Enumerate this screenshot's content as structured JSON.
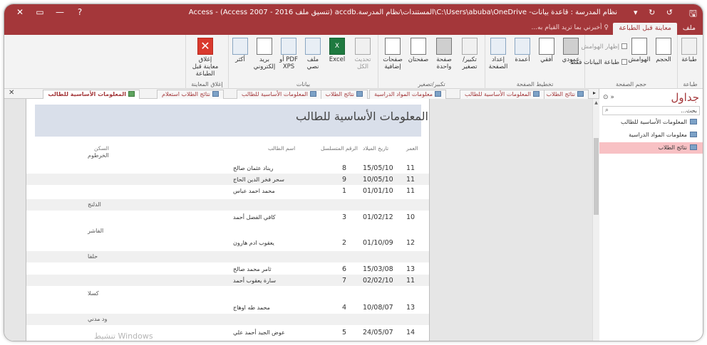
{
  "window": {
    "title": "نظام المدرسة : قاعدة بيانات- C:\\Users\\abuba\\OneDrive\\المستندات\\نظام المدرسة.accdb (تنسيق ملف 2016 - Access 2007) - Access",
    "save_icon": "save-icon",
    "quick_access": "↺ ↻ ▾",
    "controls": [
      "✕",
      "▭",
      "—",
      "?"
    ]
  },
  "tabs": {
    "file": "ملف",
    "print_preview": "معاينة قبل الطباعة",
    "tell_me": "أخبرني بما تريد القيام به..."
  },
  "ribbon": {
    "print": {
      "print": "طباعة",
      "group": "طباعة"
    },
    "page_size": {
      "size": "الحجم",
      "margins": "الهوامش",
      "show_margins": "إظهار الهوامش",
      "print_data_only": "طباعة البيانات فقط",
      "group": "حجم الصفحة"
    },
    "page_layout": {
      "portrait": "عمودي",
      "landscape": "أفقي",
      "columns": "أعمدة",
      "page_setup": "إعداد الصفحة",
      "group": "تخطيط الصفحة"
    },
    "zoom": {
      "zoom": "تكبير/تصغير",
      "one_page": "صفحة واحدة",
      "two_pages": "صفحتان",
      "more_pages": "صفحات إضافية",
      "group": "تكبير/تصغير"
    },
    "data": {
      "refresh_all": "تحديث الكل",
      "excel": "Excel",
      "text_file": "ملف نصي",
      "pdf_xps": "PDF أو XPS",
      "email": "بريد إلكتروني",
      "more": "أكثر",
      "group": "بيانات"
    },
    "close": {
      "close_preview": "إغلاق معاينة قبل الطباعة",
      "group": "إغلاق المعاينة"
    }
  },
  "doc_tabs": {
    "active": "المعلومات الأساسية للطالب",
    "tab2": "نتائج الطلاب استعلام",
    "tab3": "المعلومات الأساسية للطالب",
    "tab4": "نتائج الطلاب",
    "tab5": "معلومات المواد الدراسية",
    "tab6": "المعلومات الأساسية للطالب",
    "tab7": "نتائج الطلاب",
    "close": "✕",
    "arrow": "▸"
  },
  "nav": {
    "title": "جداول",
    "collapse": "«",
    "dropdown": "⊙",
    "search_placeholder": "بحث...",
    "search_icon": "search-icon",
    "items": [
      "المعلومات الأساسية للطالب",
      "معلومات المواد الدراسية",
      "نتائج الطلاب"
    ],
    "selected_index": 2
  },
  "report": {
    "title": "المعلومات الأساسية للطالب",
    "headers": {
      "age": "العمر",
      "dob": "تاريخ الميلاد",
      "serial": "الرقم المتسلسل",
      "name": "اسم الطالب",
      "residence": "السكن"
    },
    "groups": [
      {
        "residence": "الخرطوم",
        "rows": [
          {
            "age": "11",
            "dob": "15/05/10",
            "serial": "8",
            "name": "ريناد عثمان صالح"
          },
          {
            "age": "11",
            "dob": "10/05/10",
            "serial": "9",
            "name": "سحر فخر الدين الحاج"
          },
          {
            "age": "11",
            "dob": "01/01/10",
            "serial": "1",
            "name": "محمد احمد عباس"
          }
        ]
      },
      {
        "residence": "الدلنج",
        "rows": [
          {
            "age": "10",
            "dob": "01/02/12",
            "serial": "3",
            "name": "كافي الفضل أحمد"
          }
        ]
      },
      {
        "residence": "الفاشر",
        "rows": [
          {
            "age": "12",
            "dob": "01/10/09",
            "serial": "2",
            "name": "يعقوب ادم هارون"
          }
        ]
      },
      {
        "residence": "حلفا",
        "rows": [
          {
            "age": "13",
            "dob": "15/03/08",
            "serial": "6",
            "name": "ثامر محمد صالح"
          },
          {
            "age": "11",
            "dob": "02/02/10",
            "serial": "7",
            "name": "سارة يعقوب أحمد"
          }
        ]
      },
      {
        "residence": "كسلا",
        "rows": [
          {
            "age": "13",
            "dob": "10/08/07",
            "serial": "4",
            "name": "محمد طه اوهاج"
          }
        ]
      },
      {
        "residence": "ود مدني",
        "rows": [
          {
            "age": "14",
            "dob": "24/05/07",
            "serial": "5",
            "name": "عوض الجيد أحمد علي"
          }
        ]
      }
    ]
  },
  "watermark": "تنشيط Windows",
  "colors": {
    "accent": "#a4373a",
    "ribbon_bg": "#f3f3f3",
    "selected_nav": "#f8c1c4",
    "report_header": "#d9dfea"
  }
}
